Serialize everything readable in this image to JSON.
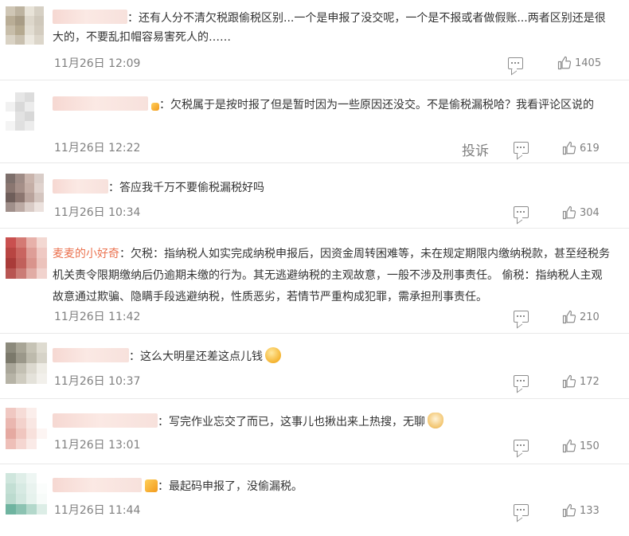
{
  "comments": [
    {
      "avatar_colors": [
        "#cfc6b5",
        "#bdb3a0",
        "#e8e3d8",
        "#d6d0c4",
        "#b9ad96",
        "#a89c86",
        "#ddd7cb",
        "#cfc8bb",
        "#c7bda9",
        "#b5a990",
        "#e2ddd2",
        "#d3ccbf",
        "#d9d2c4",
        "#c9c0af",
        "#ece8df",
        "#dcd6ca"
      ],
      "name_blur_width": 94,
      "text": "：还有人分不清欠税跟偷税区别...一个是申报了没交呢，一个是不报或者做假账...两者区别还是很大的，不要乱扣帽容易害死人的……",
      "date": "11月26日 12:09",
      "report_label": "",
      "likes": "1405"
    },
    {
      "avatar_colors": [
        "#ffffff",
        "#e6e6e6",
        "#dcdcdc",
        "#ffffff",
        "#f1f1f1",
        "#d9d9d9",
        "#ececec",
        "#ffffff",
        "#ffffff",
        "#e2e2e2",
        "#d8d8d8",
        "#ffffff",
        "#f4f4f4",
        "#e0e0e0",
        "#ececec",
        "#ffffff"
      ],
      "name_blur_width": 120,
      "text": "：欠税属于是按时报了但是暂时因为一些原因还没交。不是偷税漏税哈？我看评论区说的",
      "date": "11月26日 12:22",
      "report_label": "投诉",
      "likes": "619"
    },
    {
      "avatar_colors": [
        "#7d6f6b",
        "#9f8c86",
        "#c9b4ac",
        "#d9cdc8",
        "#8a7670",
        "#a58f88",
        "#c4aea6",
        "#e0d3ce",
        "#6f5e5a",
        "#8c7670",
        "#b9a39c",
        "#d4c5bf",
        "#a08f8a",
        "#bcaaa4",
        "#d9cbc6",
        "#ece2de"
      ],
      "name_blur_width": 70,
      "text": "：答应我千万不要偷税漏税好吗",
      "date": "11月26日 10:34",
      "report_label": "",
      "likes": "304"
    },
    {
      "avatar_colors": [
        "#c9504f",
        "#d47a74",
        "#e7b1aa",
        "#f3d8d2",
        "#b84542",
        "#c96560",
        "#de9e97",
        "#efc9c3",
        "#a93b39",
        "#c1605b",
        "#d9948c",
        "#ecc3bc",
        "#b85552",
        "#cb7c76",
        "#e1aca5",
        "#f1d3ce"
      ],
      "name_text": "麦麦的小好奇",
      "text": "：欠税：指纳税人如实完成纳税申报后，因资金周转困难等，未在规定期限内缴纳税款，甚至经税务机关责令限期缴纳后仍逾期未缴的行为。其无逃避纳税的主观故意，一般不涉及刑事责任。 偷税：指纳税人主观故意通过欺骗、隐瞒手段逃避纳税，性质恶劣，若情节严重构成犯罪，需承担刑事责任。",
      "date": "11月26日 11:42",
      "report_label": "",
      "likes": "210"
    },
    {
      "avatar_colors": [
        "#8c8a7c",
        "#a8a596",
        "#c6c3b5",
        "#dedbd0",
        "#7b796b",
        "#9b988a",
        "#bdbaac",
        "#d6d3c8",
        "#a9a699",
        "#c3c0b3",
        "#dcd9cf",
        "#eeece5",
        "#b6b3a6",
        "#cfccc0",
        "#e4e2da",
        "#f2f0eb"
      ],
      "name_blur_width": 96,
      "text": "：这么大明星还差这点儿钱",
      "emoji": "smirk-emoji",
      "date": "11月26日 10:37",
      "report_label": "",
      "likes": "172"
    },
    {
      "avatar_colors": [
        "#f0c8c2",
        "#f6dcd7",
        "#fbeeeb",
        "#ffffff",
        "#eab7b0",
        "#f3d2cc",
        "#f9e7e3",
        "#ffffff",
        "#e5a9a1",
        "#f0c6bf",
        "#f8e1dc",
        "#fdf5f3",
        "#eebfb8",
        "#f5d6d1",
        "#faeae7",
        "#ffffff"
      ],
      "name_blur_width": 132,
      "text": "：写完作业忘交了而已，这事儿也揪出来上热搜，无聊",
      "emoji": "doge-emoji",
      "date": "11月26日 13:01",
      "report_label": "",
      "likes": "150"
    },
    {
      "avatar_colors": [
        "#cfe6dd",
        "#dfeee8",
        "#eef6f3",
        "#ffffff",
        "#c3dfd4",
        "#d7eae3",
        "#e9f3ef",
        "#fbfdfc",
        "#bcdbcf",
        "#d2e7df",
        "#e6f2ed",
        "#f7fbf9",
        "#6fb4a0",
        "#8cc3b2",
        "#b3d8cb",
        "#dcede6"
      ],
      "name_blur_width": 112,
      "badge": "fan-badge-icon",
      "text": "：最起码申报了，没偷漏税。",
      "date": "11月26日 11:44",
      "report_label": "",
      "likes": "133"
    }
  ]
}
